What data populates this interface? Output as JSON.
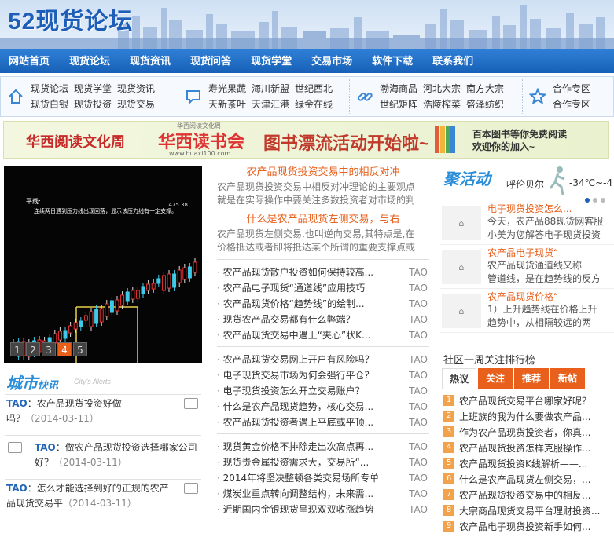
{
  "site": {
    "logo": "52现货论坛"
  },
  "nav": [
    "网站首页",
    "现货论坛",
    "现货资讯",
    "现货问答",
    "现货学堂",
    "交易市场",
    "软件下载",
    "联系我们"
  ],
  "quick": [
    {
      "icon": "home-icon",
      "links": [
        "现货论坛",
        "现货学堂",
        "现货资讯",
        "现货白银",
        "现货投资",
        "现货交易"
      ]
    },
    {
      "icon": "chat-icon",
      "links": [
        "寿光果蔬",
        "海川新盟",
        "世纪西北",
        "天新茶叶",
        "天津汇港",
        "绿金在线"
      ]
    },
    {
      "icon": "link-icon",
      "links": [
        "渤海商品",
        "河北大宗",
        "南方大宗",
        "世纪矩阵",
        "浩陵榨菜",
        "盛泽纺织"
      ]
    },
    {
      "icon": "star-icon",
      "links": [
        "合作专区",
        "合作专区"
      ]
    }
  ],
  "banner": {
    "left": "华西阅读文化周",
    "mid": "华西读书会",
    "mid_sub": "www.huaxi100.com",
    "mid_top": "华西阅读文化周",
    "main": "图书漂流活动开始啦~",
    "right1": "百本图书等你免费阅读",
    "right2": "欢迎你的加入~"
  },
  "slider": {
    "tabs": [
      "1",
      "2",
      "3",
      "4",
      "5"
    ],
    "active": 3,
    "caption1": "平线:",
    "caption2": "连续两日遇到压力线出现回落，显示该压力线有一定支撑。",
    "price": "1475.38"
  },
  "city": {
    "title": "城市",
    "title2": "快讯",
    "sub": "City's Alerts",
    "items": [
      {
        "user": "TAO",
        "text": "：农产品现货投资好做吗？",
        "date": "（2014-03-11）"
      },
      {
        "user": "TAO",
        "text": "：做农产品现货投资选择哪家公司好？",
        "date": "（2014-03-11）"
      },
      {
        "user": "TAO",
        "text": "：怎么才能选择到好的正规的农产品现货交易平",
        "date": "（2014-03-11）"
      }
    ]
  },
  "mid": {
    "headlines": [
      {
        "title": "农产品现货投资交易中的相反对冲",
        "desc1": "农产品现货投资交易中相反对冲理论的主要观点",
        "desc2": "就是在实际操作中要关注多数投资者对市场的判"
      },
      {
        "title": "什么是农产品现货左侧交易，与右",
        "desc1": "农产品现货左侧交易,也叫逆向交易,其特点是,在",
        "desc2": "价格抵达或者即将抵达某个所谓的重要支撑点或"
      }
    ],
    "lists": [
      [
        "农产品现货散户投资如何保持较高...",
        "农产品电子现货“通道线”应用技巧",
        "农产品现货价格“趋势线”的绘制...",
        "现货农产品交易都有什么弊端？",
        "农产品现货交易中遇上“夹心”状K..."
      ],
      [
        "农产品现货交易网上开户有风险吗？",
        "电子现货交易市场为何会强行平仓？",
        "电子现货投资怎么开立交易账户？",
        "什么是农产品现货趋势，核心交易...",
        "农产品现货投资者遇上平底或平顶..."
      ],
      [
        "现货黄金价格不排除走出次高点再...",
        "现货贵金属投资需求大，交易所“...",
        "2014年将坚决整顿各类交易场所专单",
        "煤炭业重点转向调整结构，未来需...",
        "近期国内金银现货呈现双双收涨趋势"
      ]
    ],
    "author": "TAO"
  },
  "right": {
    "act_title": "聚活动",
    "city": "呼伦贝尔",
    "temp": "-34℃~-4",
    "acts": [
      {
        "title": "电子现货投资怎么...",
        "desc1": "今天，农产品88现货网客服",
        "desc2": "小美为您解答电子现货投资"
      },
      {
        "title": "农产品电子现货“",
        "desc1": "农产品现货通道线又称",
        "desc2": "管道线，是在趋势线的反方"
      },
      {
        "title": "农产品现货价格“",
        "desc1": "1）上升趋势线在价格上升",
        "desc2": "趋势中，从相隔较远的两"
      }
    ],
    "img_label": "图片",
    "rank_title": "社区一周关注排行榜",
    "rank_tabs": [
      "热议",
      "关注",
      "推荐",
      "新帖"
    ],
    "rank": [
      "农产品现货交易平台哪家好呢？",
      "上班族的我为什么要做农产品...",
      "作为农产品现货投资者，你真...",
      "农产品现货投资怎样克服操作...",
      "农产品现货投资K线解析——...",
      "什么是农产品现货左侧交易，...",
      "农产品现货投资交易中的相反...",
      "大宗商品现货交易平台理财投资...",
      "农产品电子现货投资新手如何..."
    ]
  }
}
